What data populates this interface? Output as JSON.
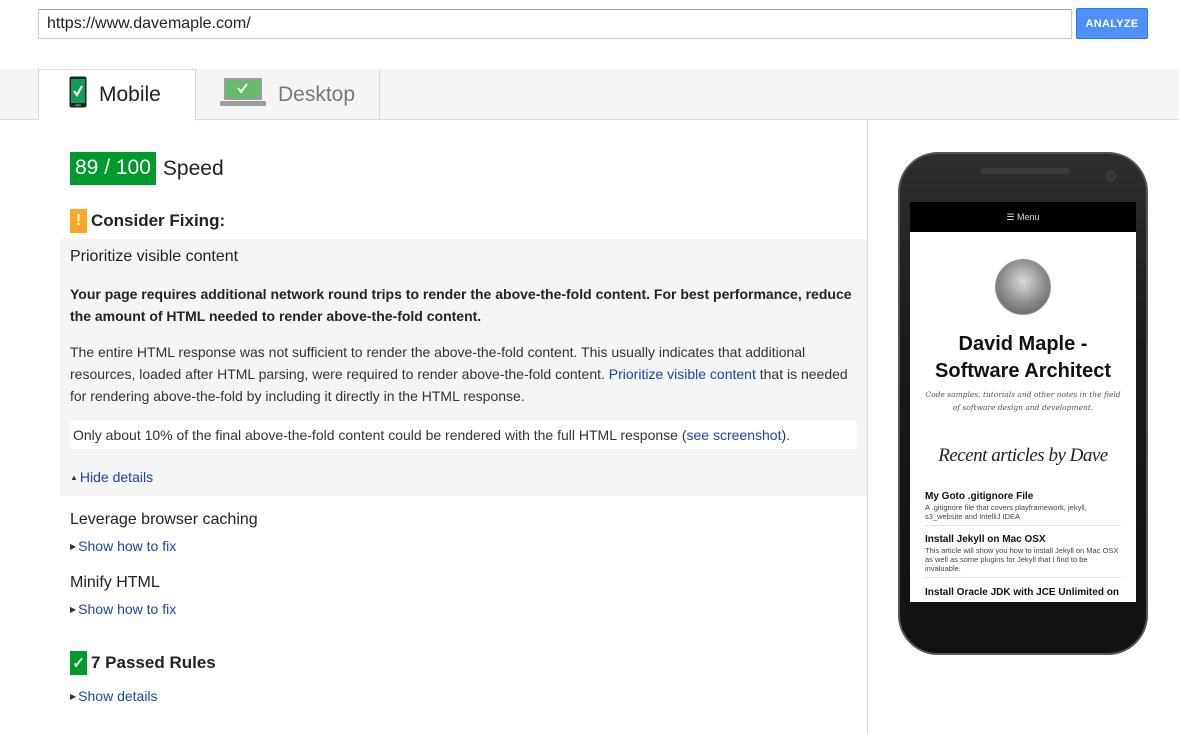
{
  "url_bar": {
    "value": "https://www.davemaple.com/",
    "analyze_label": "ANALYZE"
  },
  "tabs": [
    {
      "label": "Mobile",
      "active": true
    },
    {
      "label": "Desktop",
      "active": false
    }
  ],
  "score": {
    "value": "89 / 100",
    "label": "Speed",
    "color": "#009a2d"
  },
  "consider_fixing": {
    "heading": "Consider Fixing:",
    "badge": "!",
    "rules": [
      {
        "title": "Prioritize visible content",
        "summary": "Your page requires additional network round trips to render the above-the-fold content. For best performance, reduce the amount of HTML needed to render above-the-fold content.",
        "body_before": "The entire HTML response was not sufficient to render the above-the-fold content. This usually indicates that additional resources, loaded after HTML parsing, were required to render above-the-fold content. ",
        "body_link": "Prioritize visible content",
        "body_after": " that is needed for rendering above-the-fold by including it directly in the HTML response.",
        "note_before": "Only about 10% of the final above-the-fold content could be rendered with the full HTML response (",
        "note_link": "see screenshot",
        "note_after": ").",
        "toggle": "Hide details"
      },
      {
        "title": "Leverage browser caching",
        "toggle": "Show how to fix"
      },
      {
        "title": "Minify HTML",
        "toggle": "Show how to fix"
      }
    ]
  },
  "passed": {
    "heading": "7 Passed Rules",
    "toggle": "Show details"
  },
  "phone_preview": {
    "menu": "☰ Menu",
    "title_line1": "David Maple -",
    "title_line2": "Software Architect",
    "subtitle": "Code samples, tutorials and other notes in the field of software design and development.",
    "recent_heading": "Recent articles by Dave",
    "articles": [
      {
        "title": "My Goto .gitignore File",
        "desc": "A .gitignore file that covers playframework, jekyll, s3_website and IntelliJ IDEA"
      },
      {
        "title": "Install Jekyll on Mac OSX",
        "desc": "This article will show you how to install Jekyll on Mac OSX as well as some plugins for Jekyll that I find to be invaluable."
      },
      {
        "title": "Install Oracle JDK with JCE Unlimited on",
        "desc": ""
      }
    ]
  },
  "colors": {
    "accent": "#4d90fe",
    "link": "#1a44b2",
    "warn": "#f9a825",
    "pass": "#009a2d"
  }
}
